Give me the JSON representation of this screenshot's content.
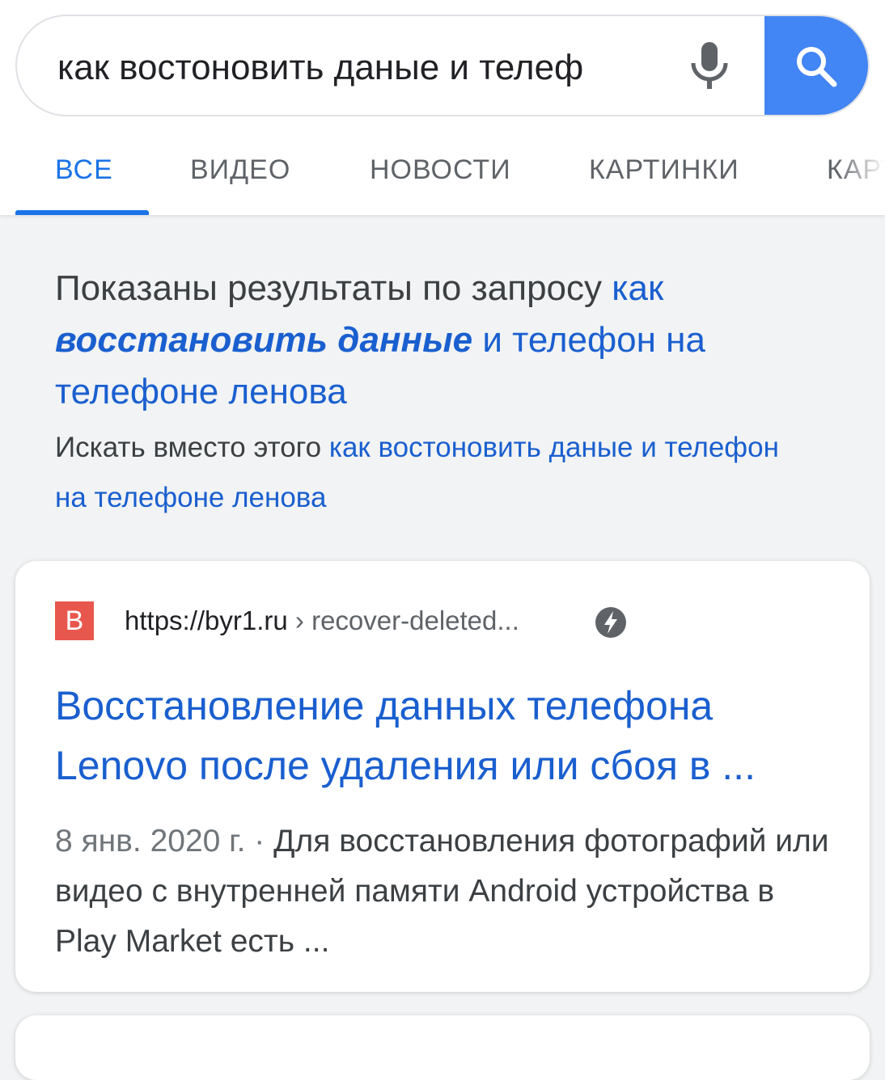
{
  "search": {
    "query": "как востоновить даные и телеф",
    "mic_icon": "mic-icon",
    "search_icon": "search-icon"
  },
  "tabs": [
    {
      "label": "ВСЕ",
      "active": true
    },
    {
      "label": "ВИДЕО",
      "active": false
    },
    {
      "label": "НОВОСТИ",
      "active": false
    },
    {
      "label": "КАРТИНКИ",
      "active": false
    },
    {
      "label": "КАРТЫ",
      "active": false
    }
  ],
  "spelling": {
    "prefix": "Показаны результаты по запросу ",
    "corrected_pre": "как",
    "corrected_bold": "восстановить данные",
    "corrected_post": " и телефон на телефоне ленова",
    "instead_prefix": "Искать вместо этого ",
    "instead_query": "как востоновить даные и телефон на телефоне ленова"
  },
  "result": {
    "favicon_letter": "B",
    "favicon_color": "#e8574d",
    "url_domain": "https://byr1.ru",
    "url_path": " › recover-deleted...",
    "amp_icon": "amp-lightning-icon",
    "title": "Восстановление данных телефона Lenovo после удаления или сбоя в ...",
    "date": "8 янв. 2020 г.",
    "separator": " · ",
    "snippet": "Для восстановления фотографий или видео с внутренней памяти Android устройства в Play Market есть ..."
  },
  "colors": {
    "accent": "#1a73e8",
    "link": "#1a5fcf",
    "search_button": "#4285f4"
  }
}
